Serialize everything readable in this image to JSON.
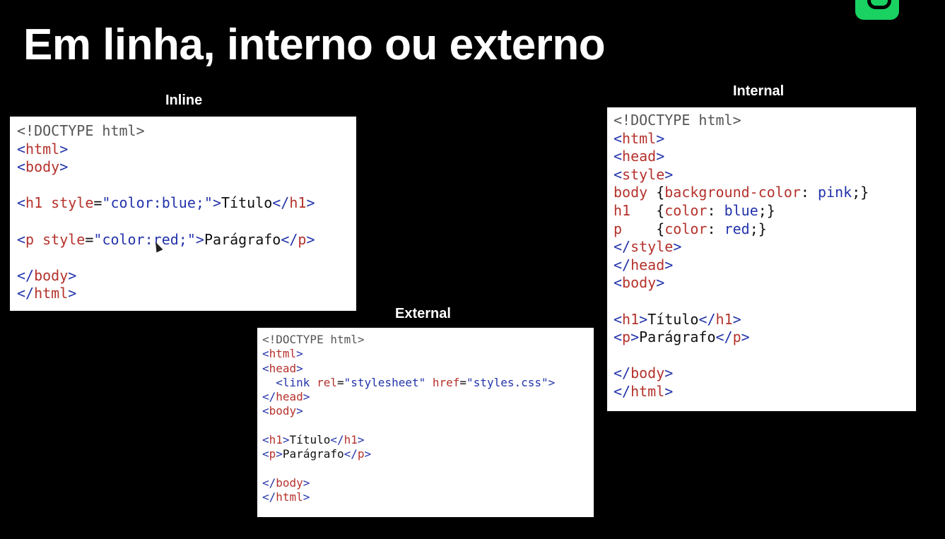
{
  "slide": {
    "title": "Em linha, interno ou externo"
  },
  "inline": {
    "caption": "Inline",
    "doctype": "<!DOCTYPE html>",
    "h1_text": "Título",
    "p_text": "Parágrafo",
    "h1_style_value": "color:blue;",
    "p_style_value": "color:red;"
  },
  "external": {
    "caption": "External",
    "doctype": "<!DOCTYPE html>",
    "rel_value": "stylesheet",
    "href_value": "styles.css",
    "h1_text": "Título",
    "p_text": "Parágrafo"
  },
  "internal": {
    "caption": "Internal",
    "doctype": "<!DOCTYPE html>",
    "css_body_prop": "background-color",
    "css_body_val": "pink",
    "css_h1_prop": "color",
    "css_h1_val": "blue",
    "css_p_prop": "color",
    "css_p_val": "red",
    "h1_text": "Título",
    "p_text": "Parágrafo"
  },
  "colors": {
    "background": "#000000",
    "tag_blue": "#2233aa",
    "name_red": "#b5322c",
    "logo_green": "#19d262"
  },
  "icons": {
    "logo": "brand-logo-icon",
    "cursor": "mouse-pointer-icon"
  }
}
